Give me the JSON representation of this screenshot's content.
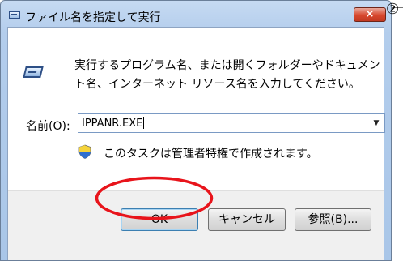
{
  "window": {
    "title": "ファイル名を指定して実行",
    "close_label": "×"
  },
  "body": {
    "description": "実行するプログラム名、または開くフォルダーやドキュメント名、インターネット リソース名を入力してください。",
    "name_label": "名前(O):",
    "name_value": "IPPANR.EXE",
    "admin_note": "このタスクは管理者特権で作成されます。"
  },
  "buttons": {
    "ok": "OK",
    "cancel": "キャンセル",
    "browse": "参照(B)..."
  },
  "annotation": {
    "step_marker": "②",
    "ellipse_color": "#e8141b"
  },
  "icons": {
    "title": "run-dialog-icon",
    "run": "run-icon",
    "shield": "uac-shield-icon",
    "dropdown": "chevron-down-icon"
  }
}
